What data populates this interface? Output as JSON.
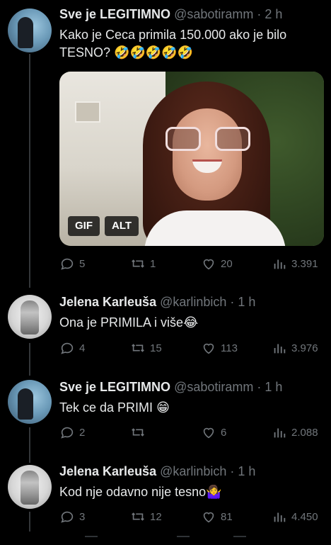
{
  "tweets": [
    {
      "name": "Sve je LEGITIMNO",
      "handle": "@sabotiramm",
      "time": "2 h",
      "text": "Kako je Ceca primila 150.000 ako je bilo TESNO?",
      "emoji": "🤣🤣🤣🤣🤣",
      "media": {
        "gif_label": "GIF",
        "alt_label": "ALT"
      },
      "reply_count": "5",
      "retweet_count": "1",
      "like_count": "20",
      "views": "3.391"
    },
    {
      "name": "Jelena Karleuša",
      "handle": "@karlinbich",
      "time": "1 h",
      "text": "Ona je PRIMILA i više",
      "emoji": "😂",
      "reply_count": "4",
      "retweet_count": "15",
      "like_count": "113",
      "views": "3.976"
    },
    {
      "name": "Sve je LEGITIMNO",
      "handle": "@sabotiramm",
      "time": "1 h",
      "text": "Tek ce da PRIMI",
      "emoji": "😁",
      "reply_count": "2",
      "retweet_count": "",
      "like_count": "6",
      "views": "2.088"
    },
    {
      "name": "Jelena Karleuša",
      "handle": "@karlinbich",
      "time": "1 h",
      "text": "Kod nje odavno nije tesno",
      "emoji": "🤷‍♀️",
      "reply_count": "3",
      "retweet_count": "12",
      "like_count": "81",
      "views": "4.450"
    }
  ],
  "separator": " · ",
  "icons": [
    "reply-icon",
    "retweet-icon",
    "like-icon",
    "views-icon"
  ]
}
